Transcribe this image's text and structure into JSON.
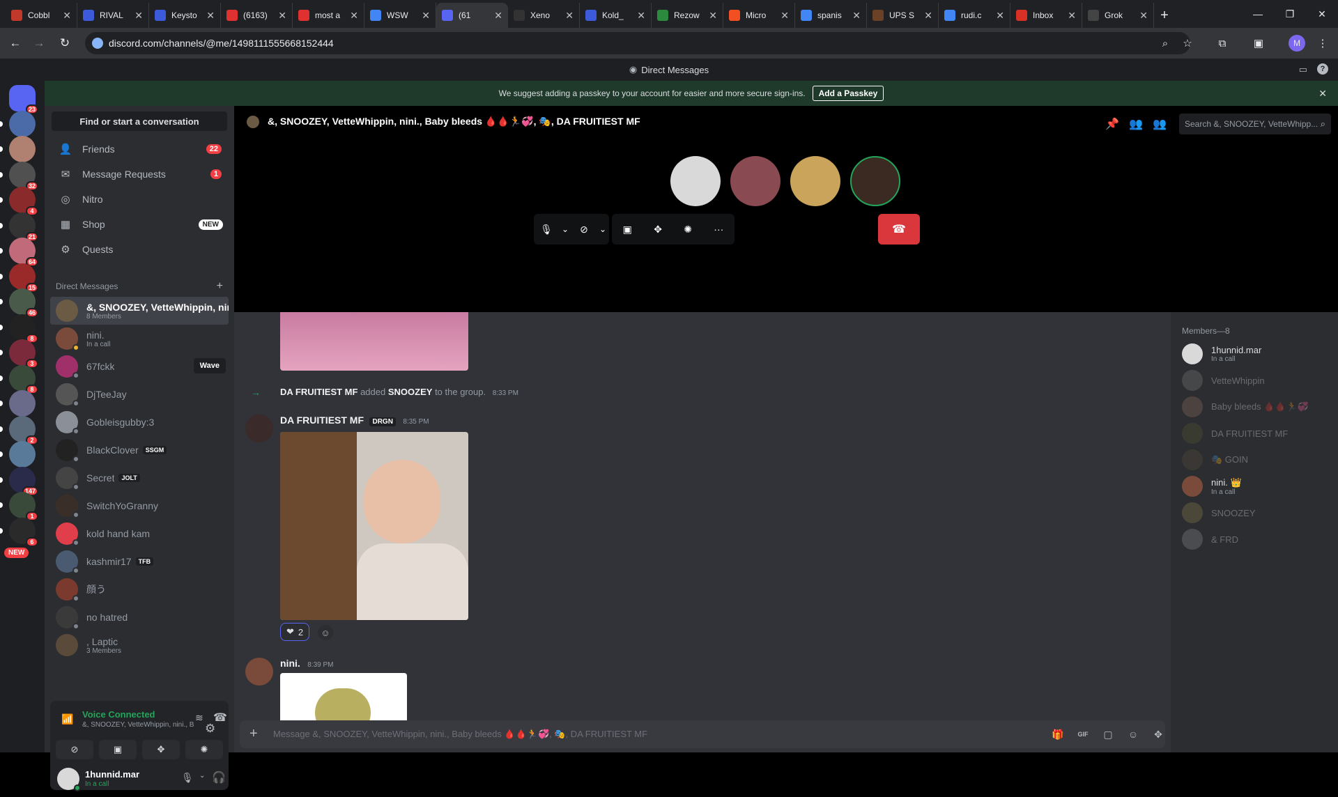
{
  "browser": {
    "tabs": [
      {
        "title": "Cobbl",
        "color": "#c0392b"
      },
      {
        "title": "RIVAL",
        "color": "#3b5bdb"
      },
      {
        "title": "Keysto",
        "color": "#3b5bdb"
      },
      {
        "title": "(6163)",
        "color": "#e03131"
      },
      {
        "title": "most a",
        "color": "#e03131"
      },
      {
        "title": "WSW",
        "color": "#4285f4"
      },
      {
        "title": "(61",
        "color": "#5865f2"
      },
      {
        "title": "Xeno",
        "color": "#333"
      },
      {
        "title": "Kold_",
        "color": "#3b5bdb"
      },
      {
        "title": "Rezow",
        "color": "#2b8a3e"
      },
      {
        "title": "Micro",
        "color": "#f25022"
      },
      {
        "title": "spanis",
        "color": "#4285f4"
      },
      {
        "title": "UPS S",
        "color": "#6b4226"
      },
      {
        "title": "rudi.c",
        "color": "#4285f4"
      },
      {
        "title": "Inbox",
        "color": "#d93025"
      },
      {
        "title": "Grok",
        "color": "#444"
      }
    ],
    "url": "discord.com/channels/@me/1498111555668152444",
    "profile_initial": "M"
  },
  "discord": {
    "window_title": "Direct Messages",
    "passkey_banner": {
      "text": "We suggest adding a passkey to your account for easier and more secure sign-ins.",
      "button": "Add a Passkey"
    },
    "guild_badges": [
      "23",
      "",
      "",
      "32",
      "4",
      "21",
      "64",
      "15",
      "46",
      "8",
      "3",
      "8",
      "",
      "2",
      "",
      "147",
      "1",
      "6"
    ],
    "new_badge": "NEW",
    "sidebar": {
      "find": "Find or start a conversation",
      "nav": [
        {
          "label": "Friends",
          "badge": "22",
          "icon": "friends-icon"
        },
        {
          "label": "Message Requests",
          "badge": "1",
          "icon": "mail-icon"
        },
        {
          "label": "Nitro",
          "badge": "",
          "icon": "nitro-icon"
        },
        {
          "label": "Shop",
          "badge": "NEW",
          "icon": "shop-icon"
        },
        {
          "label": "Quests",
          "badge": "",
          "icon": "quests-icon"
        }
      ],
      "dm_header": "Direct Messages",
      "dms": [
        {
          "name": "&, SNOOZEY, VetteWhippin, nini...",
          "sub": "8 Members",
          "tag": "",
          "color": "#6b5b45"
        },
        {
          "name": "nini.",
          "sub": "In a call",
          "tag": "",
          "color": "#7a4a3a"
        },
        {
          "name": "67fckk",
          "sub": "",
          "tag": "",
          "color": "#a0306a"
        },
        {
          "name": "DjTeeJay",
          "sub": "",
          "tag": "",
          "color": "#555"
        },
        {
          "name": "Gobleisgubby:3",
          "sub": "",
          "tag": "",
          "color": "#8a8f98"
        },
        {
          "name": "BlackClover",
          "sub": "",
          "tag": "SSGM",
          "color": "#222"
        },
        {
          "name": "Secret",
          "sub": "",
          "tag": "JOLT",
          "color": "#444"
        },
        {
          "name": "SwitchYoGranny",
          "sub": "",
          "tag": "",
          "color": "#3a2f28"
        },
        {
          "name": "kold hand kam",
          "sub": "",
          "tag": "",
          "color": "#e03e4a"
        },
        {
          "name": "kashmir17",
          "sub": "",
          "tag": "TFB",
          "color": "#4a5a70"
        },
        {
          "name": "顔う",
          "sub": "",
          "tag": "",
          "color": "#7a3b2e"
        },
        {
          "name": "no hatred",
          "sub": "",
          "tag": "",
          "color": "#3a3a3a"
        },
        {
          "name": ", Laptic",
          "sub": "3 Members",
          "tag": "",
          "color": "#5a4a3a"
        }
      ],
      "wave_label": "Wave",
      "voice": {
        "title": "Voice Connected",
        "sub": "&, SNOOZEY, VetteWhippin, nini., Baby b..."
      },
      "user": {
        "name": "1hunnid.mar",
        "status": "In a call"
      }
    },
    "channel": {
      "title": "&, SNOOZEY, VetteWhippin, nini., Baby bleeds 🩸🩸🏃💞, 🎭, DA FRUITIEST MF",
      "search_placeholder": "Search &, SNOOZEY, VetteWhipp..."
    },
    "call": {
      "participant_colors": [
        "#d9d9d9",
        "#8a4a52",
        "#c9a45a",
        "#3a2a22"
      ]
    },
    "messages": {
      "system": {
        "actor": "DA FRUITIEST MF",
        "verb": "added",
        "target": "SNOOZEY",
        "suffix": "to the group.",
        "time": "8:33 PM"
      },
      "msg1": {
        "author": "DA FRUITIEST MF",
        "tag": "DRGN",
        "time": "8:35 PM",
        "reaction_count": "2"
      },
      "msg2": {
        "author": "nini.",
        "time": "8:39 PM"
      }
    },
    "composer_placeholder": "Message &, SNOOZEY, VetteWhippin, nini., Baby bleeds 🩸🩸🏃💞, 🎭, DA FRUITIEST MF",
    "members": {
      "header": "Members—8",
      "list": [
        {
          "name": "1hunnid.mar",
          "sub": "In a call",
          "off": false,
          "color": "#d9d9d9"
        },
        {
          "name": "VetteWhippin",
          "sub": "",
          "off": true,
          "color": "#777"
        },
        {
          "name": "Baby bleeds 🩸🩸🏃💞",
          "sub": "",
          "off": true,
          "color": "#8a6a5a"
        },
        {
          "name": "DA FRUITIEST MF",
          "sub": "",
          "off": true,
          "color": "#553"
        },
        {
          "name": "🎭 GOIN",
          "sub": "",
          "off": true,
          "color": "#5a4a3a"
        },
        {
          "name": "nini. 👑",
          "sub": "In a call",
          "off": false,
          "color": "#7a4a3a"
        },
        {
          "name": "SNOOZEY",
          "sub": "",
          "off": true,
          "color": "#8a7a4a"
        },
        {
          "name": "& FRD",
          "sub": "",
          "off": true,
          "color": "#888"
        }
      ]
    }
  }
}
